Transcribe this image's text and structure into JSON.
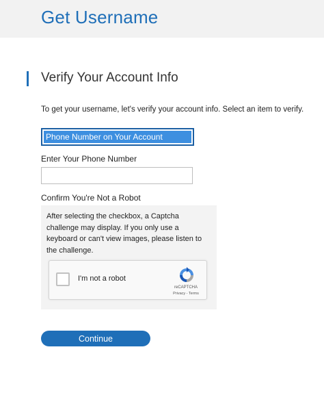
{
  "header": {
    "title": "Get Username"
  },
  "section": {
    "title": "Verify Your Account Info",
    "intro": "To get your username, let's verify your account info. Select an item to verify."
  },
  "verify_method": {
    "selected": "Phone Number on Your Account"
  },
  "phone": {
    "label": "Enter Your Phone Number",
    "value": "",
    "placeholder": ""
  },
  "robot": {
    "label": "Confirm You're Not a Robot",
    "note": "After selecting the checkbox, a Captcha challenge may display. If you only use a keyboard or can't view images, please listen to the challenge.",
    "checkbox_label": "I'm not a robot",
    "brand": "reCAPTCHA",
    "terms": "Privacy - Terms",
    "logo_icon": "recaptcha-logo-icon"
  },
  "actions": {
    "continue_label": "Continue"
  },
  "colors": {
    "accent": "#1f6fb8",
    "selection": "#3d8fe0"
  }
}
